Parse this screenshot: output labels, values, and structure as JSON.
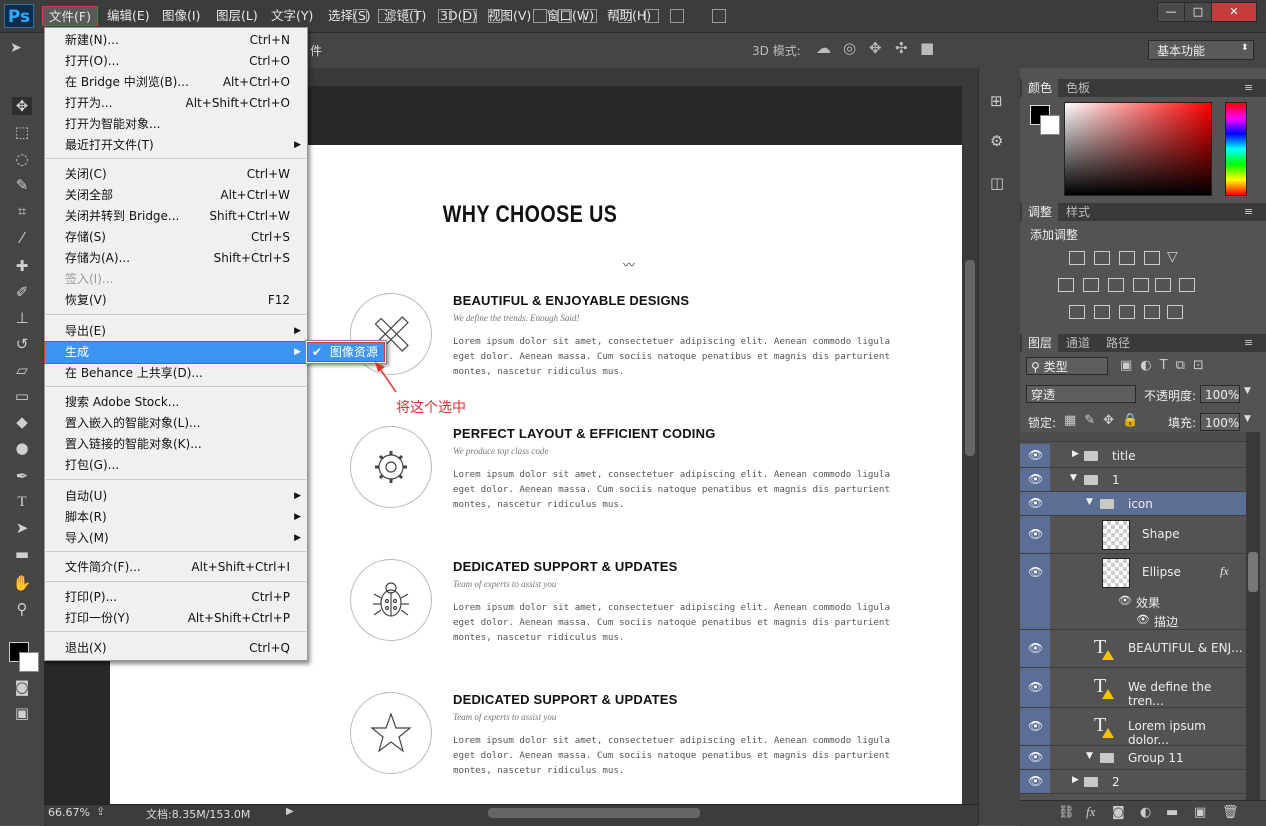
{
  "app": {
    "logo": "Ps"
  },
  "menubar": {
    "items": [
      "文件(F)",
      "编辑(E)",
      "图像(I)",
      "图层(L)",
      "文字(Y)",
      "选择(S)",
      "滤镜(T)",
      "3D(D)",
      "视图(V)",
      "窗口(W)",
      "帮助(H)"
    ]
  },
  "window_controls": {
    "minimize": "—",
    "maximize": "□",
    "close": "✕"
  },
  "options_bar": {
    "partial_label": "件",
    "mode_3d": "3D 模式:",
    "workspace": "基本功能"
  },
  "file_menu": {
    "items": [
      {
        "label": "新建(N)...",
        "shortcut": "Ctrl+N"
      },
      {
        "label": "打开(O)...",
        "shortcut": "Ctrl+O"
      },
      {
        "label": "在 Bridge 中浏览(B)...",
        "shortcut": "Alt+Ctrl+O"
      },
      {
        "label": "打开为...",
        "shortcut": "Alt+Shift+Ctrl+O"
      },
      {
        "label": "打开为智能对象...",
        "shortcut": ""
      },
      {
        "label": "最近打开文件(T)",
        "shortcut": ""
      },
      {
        "label": "关闭(C)",
        "shortcut": "Ctrl+W"
      },
      {
        "label": "关闭全部",
        "shortcut": "Alt+Ctrl+W"
      },
      {
        "label": "关闭并转到 Bridge...",
        "shortcut": "Shift+Ctrl+W"
      },
      {
        "label": "存储(S)",
        "shortcut": "Ctrl+S"
      },
      {
        "label": "存储为(A)...",
        "shortcut": "Shift+Ctrl+S"
      },
      {
        "label": "签入(I)...",
        "shortcut": ""
      },
      {
        "label": "恢复(V)",
        "shortcut": "F12"
      },
      {
        "label": "导出(E)",
        "shortcut": ""
      },
      {
        "label": "生成",
        "shortcut": ""
      },
      {
        "label": "在 Behance 上共享(D)...",
        "shortcut": ""
      },
      {
        "label": "搜索 Adobe Stock...",
        "shortcut": ""
      },
      {
        "label": "置入嵌入的智能对象(L)...",
        "shortcut": ""
      },
      {
        "label": "置入链接的智能对象(K)...",
        "shortcut": ""
      },
      {
        "label": "打包(G)...",
        "shortcut": ""
      },
      {
        "label": "自动(U)",
        "shortcut": ""
      },
      {
        "label": "脚本(R)",
        "shortcut": ""
      },
      {
        "label": "导入(M)",
        "shortcut": ""
      },
      {
        "label": "文件简介(F)...",
        "shortcut": "Alt+Shift+Ctrl+I"
      },
      {
        "label": "打印(P)...",
        "shortcut": "Ctrl+P"
      },
      {
        "label": "打印一份(Y)",
        "shortcut": "Alt+Shift+Ctrl+P"
      },
      {
        "label": "退出(X)",
        "shortcut": "Ctrl+Q"
      }
    ],
    "submenu": {
      "checkmark": "✔",
      "label": "图像资源"
    }
  },
  "annotation": "将这个选中",
  "canvas": {
    "heading": "WHY CHOOSE US",
    "features": [
      {
        "title": "BEAUTIFUL & ENJOYABLE DESIGNS",
        "subtitle": "We define the trends. Enough Said!",
        "body": "Lorem ipsum dolor sit amet, consectetuer adipiscing elit. Aenean commodo ligula eget dolor. Aenean massa. Cum sociis natoque penatibus et magnis dis parturient montes, nascetur ridiculus mus.",
        "icon": "pencil-ruler-icon"
      },
      {
        "title": "PERFECT LAYOUT & EFFICIENT CODING",
        "subtitle": "We produce top class code",
        "body": "Lorem ipsum dolor sit amet, consectetuer adipiscing elit. Aenean commodo ligula eget dolor. Aenean massa. Cum sociis natoque penatibus et magnis dis parturient montes, nascetur ridiculus mus.",
        "icon": "gear-icon"
      },
      {
        "title": "DEDICATED SUPPORT & UPDATES",
        "subtitle": "Team of experts to assist you",
        "body": "Lorem ipsum dolor sit amet, consectetuer adipiscing elit. Aenean commodo ligula eget dolor. Aenean massa. Cum sociis natoque penatibus et magnis dis parturient montes, nascetur ridiculus mus.",
        "icon": "bug-icon"
      },
      {
        "title": "DEDICATED SUPPORT & UPDATES",
        "subtitle": "Team of experts to assist you",
        "body": "Lorem ipsum dolor sit amet, consectetuer adipiscing elit. Aenean commodo ligula eget dolor. Aenean massa. Cum sociis natoque penatibus et magnis dis parturient montes, nascetur ridiculus mus.",
        "icon": "star-icon"
      }
    ]
  },
  "status": {
    "zoom": "66.67%",
    "doc": "文档:8.35M/153.0M"
  },
  "panels": {
    "color_tabs": [
      "颜色",
      "色板"
    ],
    "adjust_tabs": [
      "调整",
      "样式"
    ],
    "adjust_title": "添加调整",
    "layer_tabs": [
      "图层",
      "通道",
      "路径"
    ],
    "kind_filter": "类型",
    "blend_mode": "穿透",
    "opacity_label": "不透明度:",
    "opacity": "100%",
    "lock_label": "锁定:",
    "fill_label": "填充:",
    "fill": "100%",
    "fx_label": "fx",
    "layers": [
      {
        "name": "title",
        "type": "group",
        "expanded": false
      },
      {
        "name": "1",
        "type": "group",
        "expanded": true
      },
      {
        "name": "icon",
        "type": "group",
        "expanded": true,
        "selected": true
      },
      {
        "name": "Shape",
        "type": "shape"
      },
      {
        "name": "Ellipse",
        "type": "shape",
        "fx": true
      },
      {
        "name": "效果",
        "type": "effect"
      },
      {
        "name": "描边",
        "type": "effect-item"
      },
      {
        "name": "BEAUTIFUL & ENJ...",
        "type": "text"
      },
      {
        "name": "We define the tren...",
        "type": "text"
      },
      {
        "name": "Lorem ipsum dolor...",
        "type": "text"
      },
      {
        "name": "Group 11",
        "type": "group",
        "expanded": true
      },
      {
        "name": "2",
        "type": "group",
        "expanded": false
      }
    ]
  },
  "colors": {
    "accent": "#3d93f0",
    "highlight": "#d23c3c",
    "selected_layer": "#5c6e93"
  }
}
